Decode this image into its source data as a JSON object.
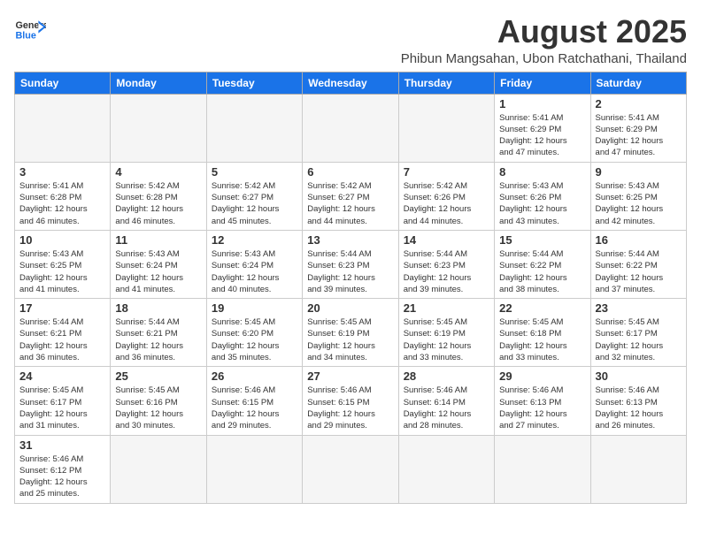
{
  "logo": {
    "general": "General",
    "blue": "Blue"
  },
  "title": {
    "month_year": "August 2025",
    "location": "Phibun Mangsahan, Ubon Ratchathani, Thailand"
  },
  "weekdays": [
    "Sunday",
    "Monday",
    "Tuesday",
    "Wednesday",
    "Thursday",
    "Friday",
    "Saturday"
  ],
  "weeks": [
    [
      {
        "day": "",
        "info": ""
      },
      {
        "day": "",
        "info": ""
      },
      {
        "day": "",
        "info": ""
      },
      {
        "day": "",
        "info": ""
      },
      {
        "day": "",
        "info": ""
      },
      {
        "day": "1",
        "info": "Sunrise: 5:41 AM\nSunset: 6:29 PM\nDaylight: 12 hours\nand 47 minutes."
      },
      {
        "day": "2",
        "info": "Sunrise: 5:41 AM\nSunset: 6:29 PM\nDaylight: 12 hours\nand 47 minutes."
      }
    ],
    [
      {
        "day": "3",
        "info": "Sunrise: 5:41 AM\nSunset: 6:28 PM\nDaylight: 12 hours\nand 46 minutes."
      },
      {
        "day": "4",
        "info": "Sunrise: 5:42 AM\nSunset: 6:28 PM\nDaylight: 12 hours\nand 46 minutes."
      },
      {
        "day": "5",
        "info": "Sunrise: 5:42 AM\nSunset: 6:27 PM\nDaylight: 12 hours\nand 45 minutes."
      },
      {
        "day": "6",
        "info": "Sunrise: 5:42 AM\nSunset: 6:27 PM\nDaylight: 12 hours\nand 44 minutes."
      },
      {
        "day": "7",
        "info": "Sunrise: 5:42 AM\nSunset: 6:26 PM\nDaylight: 12 hours\nand 44 minutes."
      },
      {
        "day": "8",
        "info": "Sunrise: 5:43 AM\nSunset: 6:26 PM\nDaylight: 12 hours\nand 43 minutes."
      },
      {
        "day": "9",
        "info": "Sunrise: 5:43 AM\nSunset: 6:25 PM\nDaylight: 12 hours\nand 42 minutes."
      }
    ],
    [
      {
        "day": "10",
        "info": "Sunrise: 5:43 AM\nSunset: 6:25 PM\nDaylight: 12 hours\nand 41 minutes."
      },
      {
        "day": "11",
        "info": "Sunrise: 5:43 AM\nSunset: 6:24 PM\nDaylight: 12 hours\nand 41 minutes."
      },
      {
        "day": "12",
        "info": "Sunrise: 5:43 AM\nSunset: 6:24 PM\nDaylight: 12 hours\nand 40 minutes."
      },
      {
        "day": "13",
        "info": "Sunrise: 5:44 AM\nSunset: 6:23 PM\nDaylight: 12 hours\nand 39 minutes."
      },
      {
        "day": "14",
        "info": "Sunrise: 5:44 AM\nSunset: 6:23 PM\nDaylight: 12 hours\nand 39 minutes."
      },
      {
        "day": "15",
        "info": "Sunrise: 5:44 AM\nSunset: 6:22 PM\nDaylight: 12 hours\nand 38 minutes."
      },
      {
        "day": "16",
        "info": "Sunrise: 5:44 AM\nSunset: 6:22 PM\nDaylight: 12 hours\nand 37 minutes."
      }
    ],
    [
      {
        "day": "17",
        "info": "Sunrise: 5:44 AM\nSunset: 6:21 PM\nDaylight: 12 hours\nand 36 minutes."
      },
      {
        "day": "18",
        "info": "Sunrise: 5:44 AM\nSunset: 6:21 PM\nDaylight: 12 hours\nand 36 minutes."
      },
      {
        "day": "19",
        "info": "Sunrise: 5:45 AM\nSunset: 6:20 PM\nDaylight: 12 hours\nand 35 minutes."
      },
      {
        "day": "20",
        "info": "Sunrise: 5:45 AM\nSunset: 6:19 PM\nDaylight: 12 hours\nand 34 minutes."
      },
      {
        "day": "21",
        "info": "Sunrise: 5:45 AM\nSunset: 6:19 PM\nDaylight: 12 hours\nand 33 minutes."
      },
      {
        "day": "22",
        "info": "Sunrise: 5:45 AM\nSunset: 6:18 PM\nDaylight: 12 hours\nand 33 minutes."
      },
      {
        "day": "23",
        "info": "Sunrise: 5:45 AM\nSunset: 6:17 PM\nDaylight: 12 hours\nand 32 minutes."
      }
    ],
    [
      {
        "day": "24",
        "info": "Sunrise: 5:45 AM\nSunset: 6:17 PM\nDaylight: 12 hours\nand 31 minutes."
      },
      {
        "day": "25",
        "info": "Sunrise: 5:45 AM\nSunset: 6:16 PM\nDaylight: 12 hours\nand 30 minutes."
      },
      {
        "day": "26",
        "info": "Sunrise: 5:46 AM\nSunset: 6:15 PM\nDaylight: 12 hours\nand 29 minutes."
      },
      {
        "day": "27",
        "info": "Sunrise: 5:46 AM\nSunset: 6:15 PM\nDaylight: 12 hours\nand 29 minutes."
      },
      {
        "day": "28",
        "info": "Sunrise: 5:46 AM\nSunset: 6:14 PM\nDaylight: 12 hours\nand 28 minutes."
      },
      {
        "day": "29",
        "info": "Sunrise: 5:46 AM\nSunset: 6:13 PM\nDaylight: 12 hours\nand 27 minutes."
      },
      {
        "day": "30",
        "info": "Sunrise: 5:46 AM\nSunset: 6:13 PM\nDaylight: 12 hours\nand 26 minutes."
      }
    ],
    [
      {
        "day": "31",
        "info": "Sunrise: 5:46 AM\nSunset: 6:12 PM\nDaylight: 12 hours\nand 25 minutes."
      },
      {
        "day": "",
        "info": ""
      },
      {
        "day": "",
        "info": ""
      },
      {
        "day": "",
        "info": ""
      },
      {
        "day": "",
        "info": ""
      },
      {
        "day": "",
        "info": ""
      },
      {
        "day": "",
        "info": ""
      }
    ]
  ]
}
